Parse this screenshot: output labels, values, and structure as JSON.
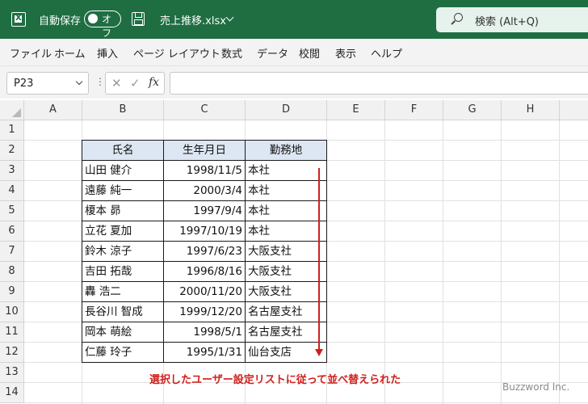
{
  "titlebar": {
    "autosave_label": "自動保存",
    "autosave_state": "オフ",
    "filename": "売上推移.xlsx",
    "search_placeholder": "検索 (Alt+Q)"
  },
  "menu": [
    "ファイル",
    "ホーム",
    "挿入",
    "ページ レイアウト",
    "数式",
    "データ",
    "校閲",
    "表示",
    "ヘルプ"
  ],
  "formula_bar": {
    "name_box": "P23",
    "function_label": "fx",
    "formula": ""
  },
  "columns": [
    "A",
    "B",
    "C",
    "D",
    "E",
    "F",
    "G",
    "H"
  ],
  "rows": [
    "1",
    "2",
    "3",
    "4",
    "5",
    "6",
    "7",
    "8",
    "9",
    "10",
    "11",
    "12",
    "13",
    "14"
  ],
  "table": {
    "headers": [
      "氏名",
      "生年月日",
      "勤務地"
    ],
    "rows": [
      [
        "山田 健介",
        "1998/11/5",
        "本社"
      ],
      [
        "遠藤 純一",
        "2000/3/4",
        "本社"
      ],
      [
        "榎本 昴",
        "1997/9/4",
        "本社"
      ],
      [
        "立花 夏加",
        "1997/10/19",
        "本社"
      ],
      [
        "鈴木 涼子",
        "1997/6/23",
        "大阪支社"
      ],
      [
        "吉田 拓哉",
        "1996/8/16",
        "大阪支社"
      ],
      [
        "轟 浩二",
        "2000/11/20",
        "大阪支社"
      ],
      [
        "長谷川 智成",
        "1999/12/20",
        "名古屋支社"
      ],
      [
        "岡本 萌絵",
        "1998/5/1",
        "名古屋支社"
      ],
      [
        "仁藤 玲子",
        "1995/1/31",
        "仙台支店"
      ]
    ]
  },
  "annotation": "選択したユーザー設定リストに従って並べ替えられた",
  "watermark": "Buzzword Inc.",
  "colors": {
    "title_bar": "#1e6e42",
    "header_fill": "#dde7f3",
    "annotation": "#d0201c"
  }
}
